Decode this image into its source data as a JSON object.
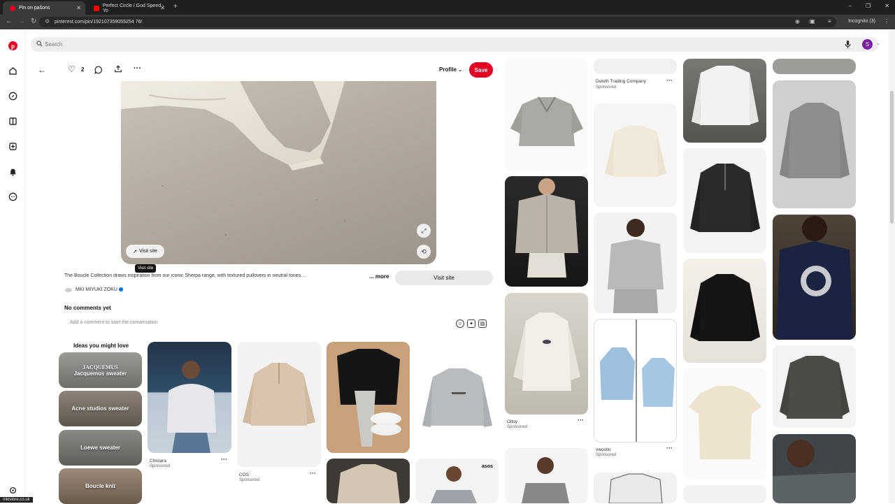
{
  "browser": {
    "tabs": [
      {
        "title": "Pin on pašons",
        "active": true
      },
      {
        "title": "Perfect Circle / God Speed - Yo",
        "active": false
      }
    ],
    "url": "pinterest.com/pin/192107359055254 76/",
    "incognito": "Incognito (3)",
    "status_url": "mkistore.co.uk"
  },
  "app": {
    "search_placeholder": "Search",
    "avatar_initial": "S",
    "accent": "#e60023"
  },
  "pin": {
    "likes": "2",
    "profile_label": "Profile",
    "save_label": "Save",
    "visit_pill": "Visit site",
    "tooltip": "Visit site",
    "description": "The Boucle Collection draws inspiration from our iconic Sherpa range, with textured pullovers in neutral tones....",
    "more": "... more",
    "visit_button": "Visit site",
    "creator": "MKI MIYUKI ZOKU",
    "comments_title": "No comments yet",
    "comment_placeholder": "Add a comment to start the conversation"
  },
  "ideas": {
    "title": "Ideas you might love",
    "items": [
      "Jacquemus sweater",
      "Acne studios sweater",
      "Loewe sweater",
      "Boucle knit"
    ],
    "jacquemus_logo": "JACQUEMUS"
  },
  "feed": {
    "duluth": {
      "name": "Duluth Trading Company",
      "sponsored": "Sponsored"
    },
    "oitoy": {
      "name": "Oitoy",
      "sponsored": "Sponsored"
    },
    "vwoollo": {
      "name": "vwoollo",
      "sponsored": "Sponsored"
    },
    "chiciara": {
      "name": "Chiciara",
      "sponsored": "Sponsored"
    },
    "cos": {
      "name": "COS",
      "sponsored": "Sponsored"
    },
    "asos": "asos"
  }
}
